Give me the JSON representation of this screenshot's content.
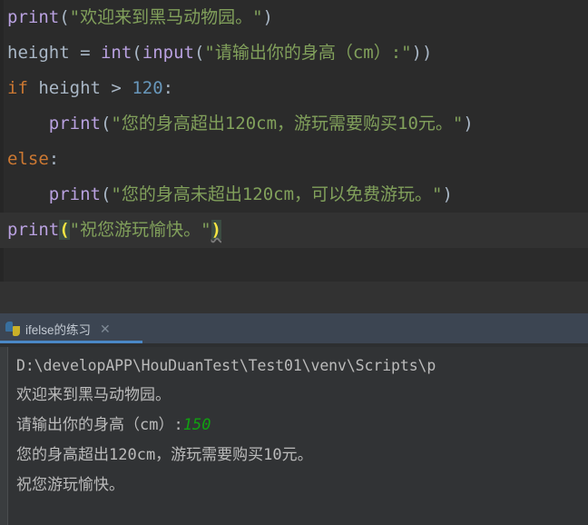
{
  "theme": {
    "editor_bg": "#2b2b2b",
    "current_line_bg": "#323232",
    "console_bg": "#313335",
    "tabbar_bg": "#3c4552",
    "tab_underline": "#4a88c7",
    "builtin_color": "#b9a1e0",
    "string_color": "#81a05b",
    "keyword_color": "#cc7832",
    "number_color": "#6897bb",
    "default_text_color": "#a9b7c6",
    "brace_match_color": "#f5e642",
    "brace_match_bg": "#3b4c42",
    "console_text_color": "#bbbbbb",
    "user_input_color": "#11a011"
  },
  "editor": {
    "lines": [
      {
        "id": 1,
        "current": false,
        "tokens": [
          {
            "t": "print",
            "c": "tok-builtin"
          },
          {
            "t": "(",
            "c": "tok-punc"
          },
          {
            "t": "\"欢迎来到黑马动物园。\"",
            "c": "tok-string"
          },
          {
            "t": ")",
            "c": "tok-punc"
          }
        ]
      },
      {
        "id": 2,
        "current": false,
        "tokens": [
          {
            "t": "height",
            "c": "tok-ident"
          },
          {
            "t": " = ",
            "c": "tok-op"
          },
          {
            "t": "int",
            "c": "tok-builtin"
          },
          {
            "t": "(",
            "c": "tok-punc"
          },
          {
            "t": "input",
            "c": "tok-builtin"
          },
          {
            "t": "(",
            "c": "tok-punc"
          },
          {
            "t": "\"请输出你的身高（cm）:\"",
            "c": "tok-string"
          },
          {
            "t": "))",
            "c": "tok-punc"
          }
        ]
      },
      {
        "id": 3,
        "current": false,
        "tokens": [
          {
            "t": "if",
            "c": "tok-kw"
          },
          {
            "t": " height ",
            "c": "tok-ident"
          },
          {
            "t": ">",
            "c": "tok-op"
          },
          {
            "t": " ",
            "c": "tok-op"
          },
          {
            "t": "120",
            "c": "tok-num"
          },
          {
            "t": ":",
            "c": "tok-punc"
          }
        ]
      },
      {
        "id": 4,
        "current": false,
        "tokens": [
          {
            "t": "    ",
            "c": "tok-op"
          },
          {
            "t": "print",
            "c": "tok-builtin"
          },
          {
            "t": "(",
            "c": "tok-punc"
          },
          {
            "t": "\"您的身高超出120cm，游玩需要购买10元。\"",
            "c": "tok-string"
          },
          {
            "t": ")",
            "c": "tok-punc"
          }
        ]
      },
      {
        "id": 5,
        "current": false,
        "tokens": [
          {
            "t": "else",
            "c": "tok-kw"
          },
          {
            "t": ":",
            "c": "tok-punc"
          }
        ]
      },
      {
        "id": 6,
        "current": false,
        "tokens": [
          {
            "t": "    ",
            "c": "tok-op"
          },
          {
            "t": "print",
            "c": "tok-builtin"
          },
          {
            "t": "(",
            "c": "tok-punc"
          },
          {
            "t": "\"您的身高未超出120cm，可以免费游玩。\"",
            "c": "tok-string"
          },
          {
            "t": ")",
            "c": "tok-punc"
          }
        ]
      },
      {
        "id": 7,
        "current": true,
        "tokens": [
          {
            "t": "print",
            "c": "tok-builtin"
          },
          {
            "t": "(",
            "c": "brace-match"
          },
          {
            "t": "\"祝您游玩愉快。\"",
            "c": "tok-string"
          },
          {
            "t": ")",
            "c": "brace-match wavy"
          }
        ]
      }
    ]
  },
  "console_panel": {
    "tab": {
      "label": "ifelse的练习",
      "icon": "python-icon",
      "close_label": "✕",
      "active": true
    },
    "output_lines": [
      {
        "segments": [
          {
            "text": "D:\\developAPP\\HouDuanTest\\Test01\\venv\\Scripts\\p",
            "style": "normal"
          }
        ],
        "mono_path": true
      },
      {
        "segments": [
          {
            "text": "欢迎来到黑马动物园。",
            "style": "normal"
          }
        ],
        "mono_path": false
      },
      {
        "segments": [
          {
            "text": "请输出你的身高（cm）:",
            "style": "normal"
          },
          {
            "text": "150",
            "style": "user-input"
          }
        ],
        "mono_path": false
      },
      {
        "segments": [
          {
            "text": "您的身高超出120cm，游玩需要购买10元。",
            "style": "normal"
          }
        ],
        "mono_path": false
      },
      {
        "segments": [
          {
            "text": "祝您游玩愉快。",
            "style": "normal"
          }
        ],
        "mono_path": false
      }
    ]
  }
}
